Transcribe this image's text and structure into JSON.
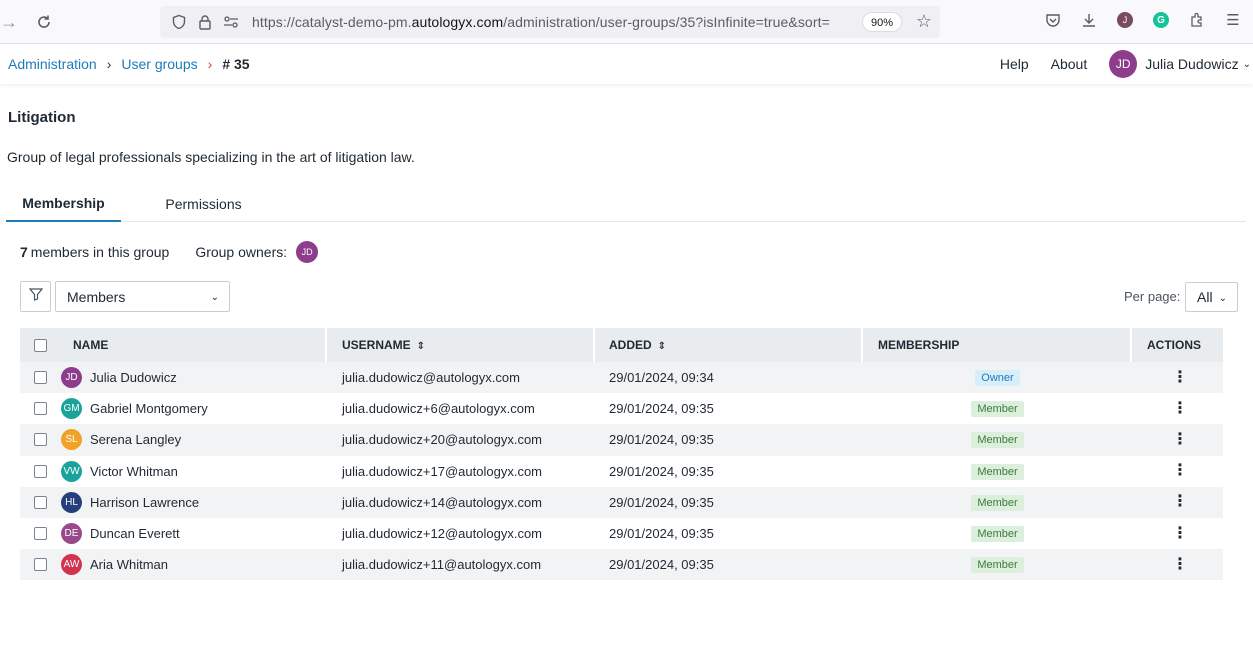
{
  "browser": {
    "url_prefix": "https://catalyst-demo-pm.",
    "url_domain": "autologyx.com",
    "url_suffix": "/administration/user-groups/35?isInfinite=true&sort=",
    "zoom": "90%",
    "profile_initial": "J",
    "grammarly_letter": "G"
  },
  "header": {
    "breadcrumbs": [
      "Administration",
      "User groups"
    ],
    "current": "# 35",
    "help": "Help",
    "about": "About",
    "user_initials": "JD",
    "user_name": "Julia Dudowicz"
  },
  "group": {
    "title": "Litigation",
    "description": "Group of legal professionals specializing in the art of litigation law."
  },
  "tabs": [
    "Membership",
    "Permissions"
  ],
  "summary": {
    "count": "7",
    "count_text": "members in this group",
    "owners_label": "Group owners:",
    "owner_initials": "JD"
  },
  "filters": {
    "members_select": "Members",
    "per_page_label": "Per page:",
    "per_page_value": "All"
  },
  "table": {
    "headers": {
      "name": "NAME",
      "username": "USERNAME",
      "added": "ADDED",
      "membership": "MEMBERSHIP",
      "actions": "ACTIONS"
    },
    "rows": [
      {
        "initials": "JD",
        "color": "#8e3d8c",
        "name": "Julia Dudowicz",
        "username": "julia.dudowicz@autologyx.com",
        "added": "29/01/2024, 09:34",
        "membership": "Owner"
      },
      {
        "initials": "GM",
        "color": "#1aa39a",
        "name": "Gabriel Montgomery",
        "username": "julia.dudowicz+6@autologyx.com",
        "added": "29/01/2024, 09:35",
        "membership": "Member"
      },
      {
        "initials": "SL",
        "color": "#f0a126",
        "name": "Serena Langley",
        "username": "julia.dudowicz+20@autologyx.com",
        "added": "29/01/2024, 09:35",
        "membership": "Member"
      },
      {
        "initials": "VW",
        "color": "#1aa39a",
        "name": "Victor Whitman",
        "username": "julia.dudowicz+17@autologyx.com",
        "added": "29/01/2024, 09:35",
        "membership": "Member"
      },
      {
        "initials": "HL",
        "color": "#263e7a",
        "name": "Harrison Lawrence",
        "username": "julia.dudowicz+14@autologyx.com",
        "added": "29/01/2024, 09:35",
        "membership": "Member"
      },
      {
        "initials": "DE",
        "color": "#9a4a8c",
        "name": "Duncan Everett",
        "username": "julia.dudowicz+12@autologyx.com",
        "added": "29/01/2024, 09:35",
        "membership": "Member"
      },
      {
        "initials": "AW",
        "color": "#d0344f",
        "name": "Aria Whitman",
        "username": "julia.dudowicz+11@autologyx.com",
        "added": "29/01/2024, 09:35",
        "membership": "Member"
      }
    ]
  }
}
